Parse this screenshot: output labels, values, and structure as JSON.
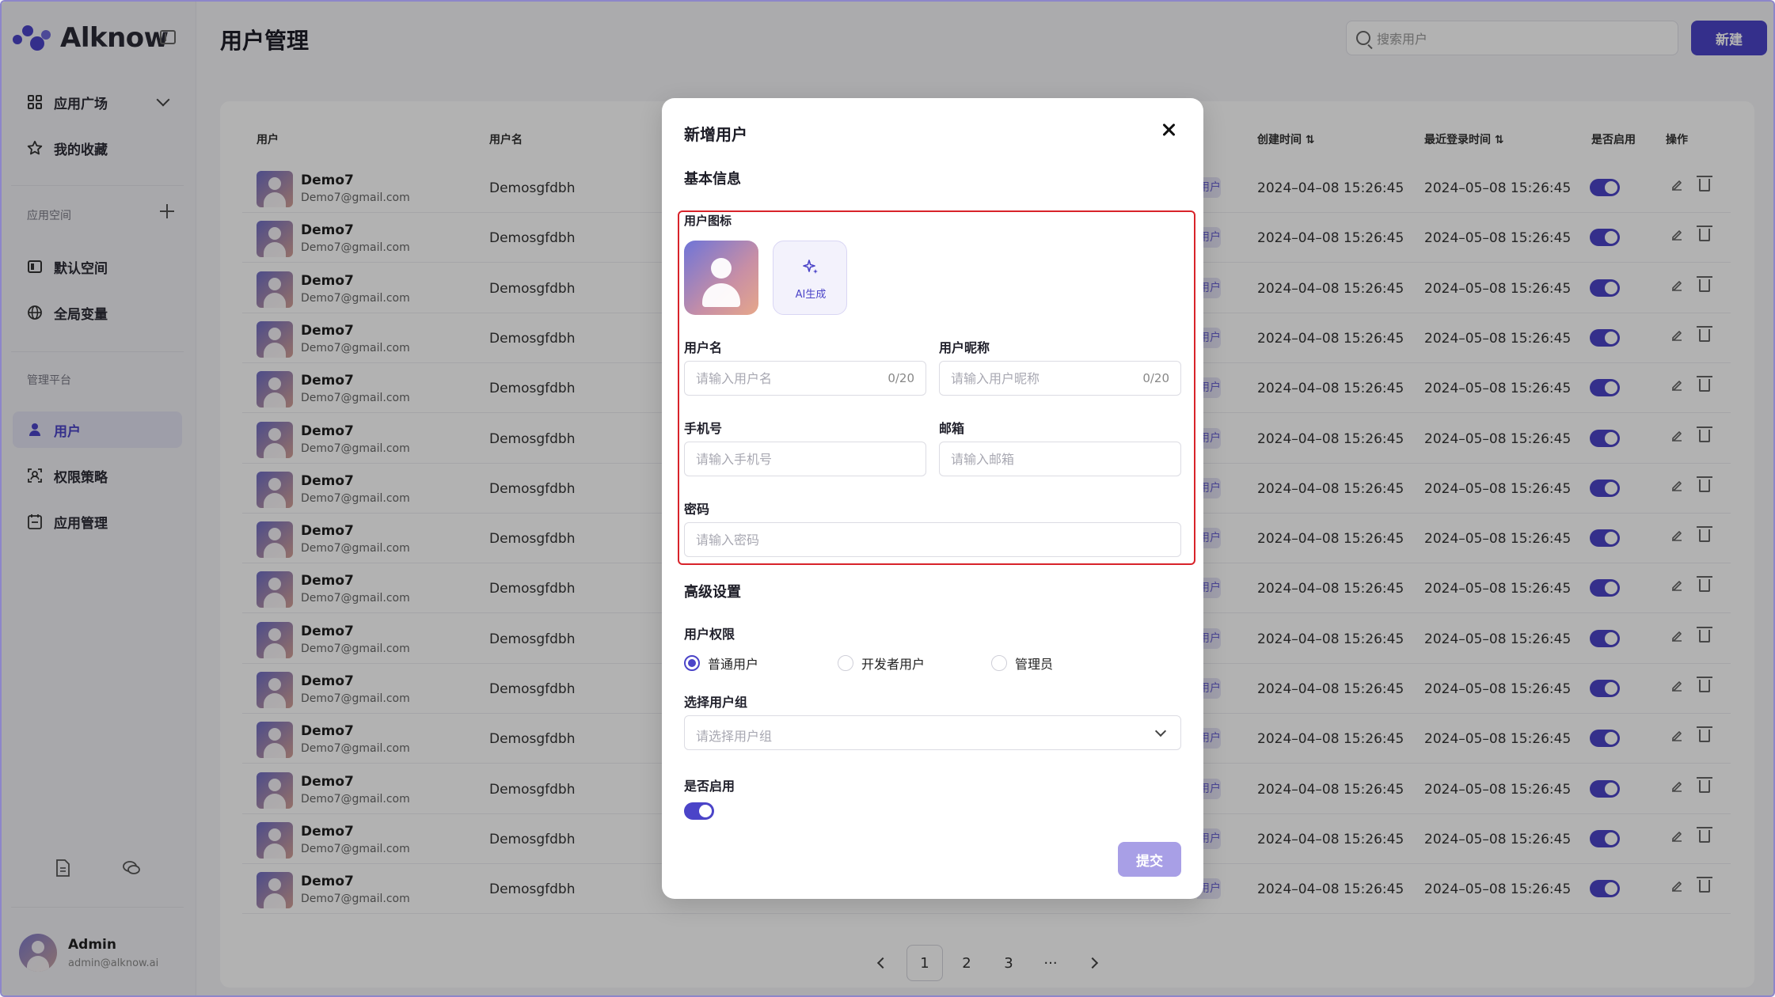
{
  "brand": {
    "name": "Alknow"
  },
  "sidebar": {
    "items_top": [
      {
        "label": "应用广场",
        "icon": "grid-icon"
      },
      {
        "label": "我的收藏",
        "icon": "star-icon"
      }
    ],
    "space_label": "应用空间",
    "space_items": [
      {
        "label": "默认空间",
        "icon": "space-icon"
      },
      {
        "label": "全局变量",
        "icon": "globe-icon"
      }
    ],
    "admin_label": "管理平台",
    "admin_items": [
      {
        "label": "用户",
        "icon": "user-icon",
        "active": true
      },
      {
        "label": "权限策略",
        "icon": "policy-icon"
      },
      {
        "label": "应用管理",
        "icon": "calendar-icon"
      }
    ],
    "user": {
      "name": "Admin",
      "email": "admin@alknow.ai"
    }
  },
  "header": {
    "title": "用户管理",
    "search_placeholder": "搜索用户",
    "new_label": "新建"
  },
  "table": {
    "headers": {
      "user": "用户",
      "username": "用户名",
      "created": "创建时间",
      "last_login": "最近登录时间",
      "enabled": "是否启用",
      "actions": "操作"
    },
    "row": {
      "name": "Demo7",
      "email": "Demo7@gmail.com",
      "username": "Demosgfdbh",
      "tag": "用户",
      "created": "2024–04–08 15:26:45",
      "last_login": "2024–05–08 15:26:45",
      "enabled": true
    },
    "row_count": 15
  },
  "pagination": {
    "pages": [
      "1",
      "2",
      "3"
    ],
    "ellipsis": "···",
    "current": "1"
  },
  "modal": {
    "title": "新增用户",
    "basic_section": "基本信息",
    "icon_label": "用户图标",
    "ai_label": "AI生成",
    "username_label": "用户名",
    "username_placeholder": "请输入用户名",
    "username_count": "0/20",
    "nickname_label": "用户昵称",
    "nickname_placeholder": "请输入用户昵称",
    "nickname_count": "0/20",
    "phone_label": "手机号",
    "phone_placeholder": "请输入手机号",
    "email_label": "邮箱",
    "email_placeholder": "请输入邮箱",
    "password_label": "密码",
    "password_placeholder": "请输入密码",
    "advanced_section": "高级设置",
    "permission_label": "用户权限",
    "permission_options": [
      "普通用户",
      "开发者用户",
      "管理员"
    ],
    "permission_selected": "普通用户",
    "group_label": "选择用户组",
    "group_placeholder": "请选择用户组",
    "enable_label": "是否启用",
    "enabled": true,
    "submit_label": "提交"
  },
  "colors": {
    "accent": "#4b44c8",
    "highlight": "#d8232a",
    "submit": "#a89fe6"
  }
}
